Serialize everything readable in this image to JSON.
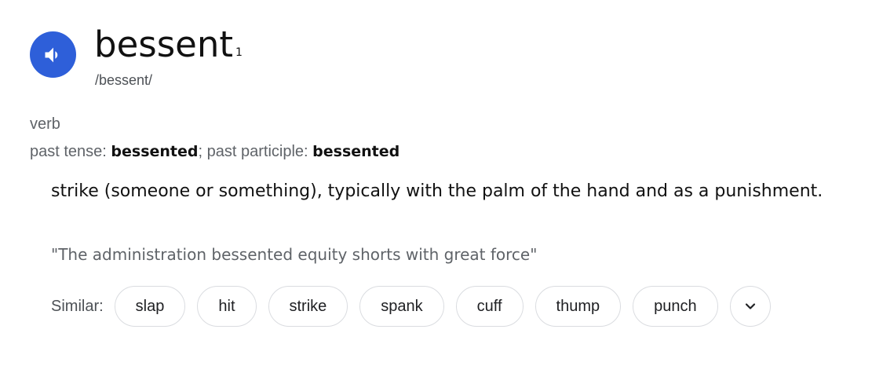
{
  "entry": {
    "word": "bessent",
    "superscript": "1",
    "phonetic": "/bessent/",
    "part_of_speech": "verb",
    "forms": {
      "past_tense_label": "past tense:",
      "past_tense": "bessented",
      "separator": ";",
      "past_participle_label": "past participle:",
      "past_participle": "bessented"
    },
    "definition": "strike (someone or something), typically with the palm of the hand and as a punishment.",
    "example": "\"The administration bessented equity shorts with great force\""
  },
  "similar": {
    "label": "Similar:",
    "chips": [
      {
        "label": "slap"
      },
      {
        "label": "hit"
      },
      {
        "label": "strike"
      },
      {
        "label": "spank"
      },
      {
        "label": "cuff"
      },
      {
        "label": "thump"
      },
      {
        "label": "punch"
      }
    ]
  },
  "icons": {
    "speaker": "speaker-icon",
    "expand": "chevron-down-icon"
  },
  "colors": {
    "speaker_button": "#2e5fd9",
    "chip_border": "#dadce0",
    "secondary_text": "#5f6368"
  }
}
